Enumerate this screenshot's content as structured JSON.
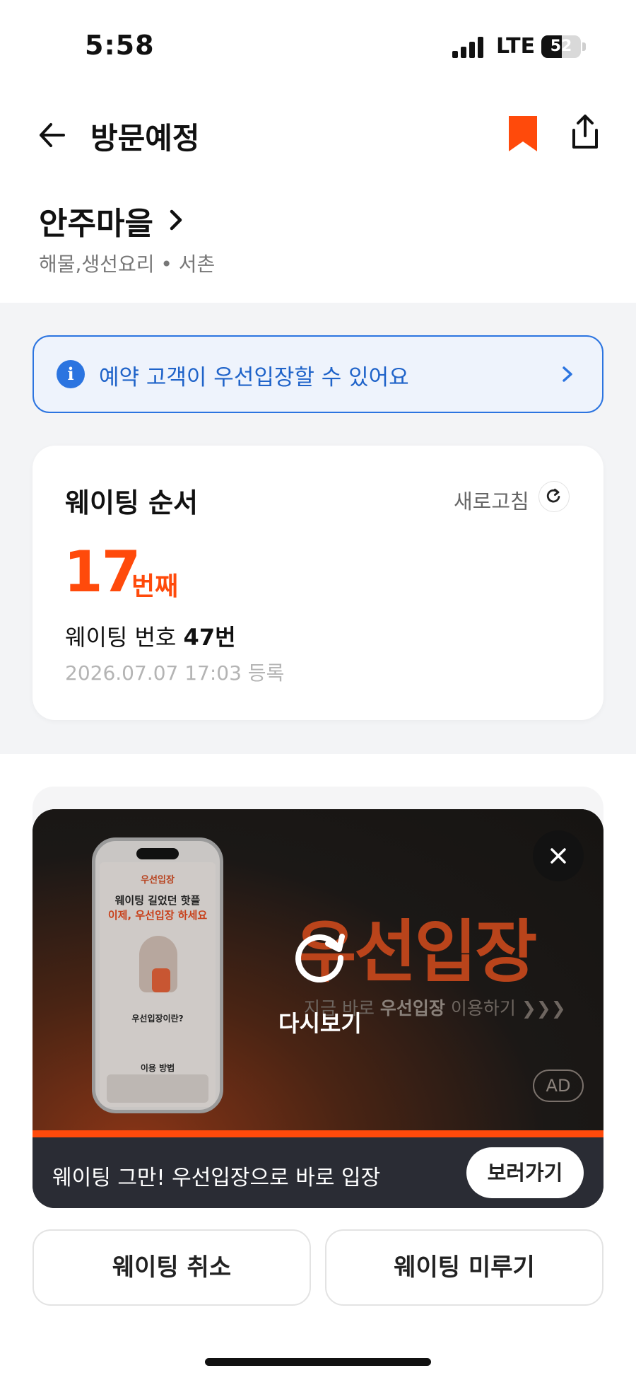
{
  "status_bar": {
    "time": "5:58",
    "network": "LTE",
    "battery": "52",
    "battery_level": 0.52
  },
  "nav": {
    "title": "방문예정",
    "back_icon": "arrow-left-icon",
    "bookmark_icon": "bookmark-icon",
    "share_icon": "share-icon"
  },
  "store": {
    "name": "안주마을",
    "category_location": "해물,생선요리 • 서촌"
  },
  "notice": {
    "text": "예약 고객이 우선입장할 수 있어요",
    "icon": "info-icon"
  },
  "waiting": {
    "heading": "웨이팅 순서",
    "refresh_label": "새로고침",
    "order": "17",
    "order_unit": "번째",
    "number_prefix": "웨이팅 번호",
    "number": "47번",
    "registered": "2026.07.07 17:03 등록"
  },
  "ad": {
    "headline": "우선입장",
    "subline_prefix": "지금 바로",
    "subline_bold": "우선입장",
    "subline_suffix": "이용하기 ❯❯❯",
    "replay_label": "다시보기",
    "ad_badge": "AD",
    "phone_preview": {
      "title": "우선입장",
      "line1": "웨이팅 길었던 핫플",
      "line2": "이제, 우선입장 하세요",
      "question": "우선입장이란?",
      "how": "이용 방법"
    },
    "bottom_text": "웨이팅 그만! 우선입장으로 바로 입장",
    "cta": "보러가기",
    "accent": "#ff4a0b"
  },
  "actions": {
    "cancel": "웨이팅 취소",
    "delay": "웨이팅 미루기"
  },
  "colors": {
    "accent": "#ff4a0b",
    "info_blue": "#2b74e0"
  }
}
